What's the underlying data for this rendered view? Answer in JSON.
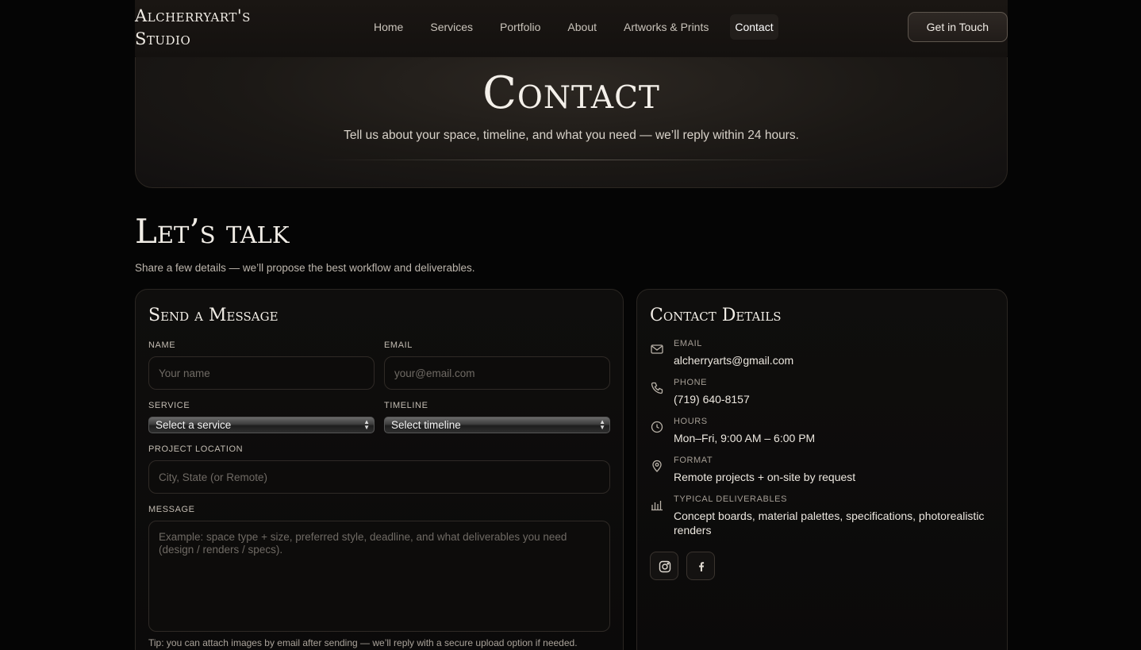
{
  "header": {
    "brand_line1": "Alcherryart's",
    "brand_line2": "Studio",
    "nav": [
      "Home",
      "Services",
      "Portfolio",
      "About",
      "Artworks & Prints",
      "Contact"
    ],
    "active_nav": "Contact",
    "cta_label": "Get in Touch"
  },
  "hero": {
    "title": "Contact",
    "subtitle": "Tell us about your space, timeline, and what you need — we’ll reply within 24 hours."
  },
  "section": {
    "title": "Let’s talk",
    "subtitle": "Share a few details — we’ll propose the best workflow and deliverables."
  },
  "form": {
    "title": "Send a Message",
    "name_label": "NAME",
    "name_placeholder": "Your name",
    "email_label": "EMAIL",
    "email_placeholder": "your@email.com",
    "service_label": "SERVICE",
    "service_value": "Select a service",
    "timeline_label": "TIMELINE",
    "timeline_value": "Select timeline",
    "location_label": "PROJECT LOCATION",
    "location_placeholder": "City, State (or Remote)",
    "message_label": "MESSAGE",
    "message_placeholder": "Example: space type + size, preferred style, deadline, and what deliverables you need (design / renders / specs).",
    "tip": "Tip: you can attach images by email after sending — we’ll reply with a secure upload option if needed."
  },
  "details": {
    "title": "Contact Details",
    "items": [
      {
        "icon": "mail-icon",
        "label": "EMAIL",
        "value": "alcherryarts@gmail.com"
      },
      {
        "icon": "phone-icon",
        "label": "PHONE",
        "value": "(719) 640-8157"
      },
      {
        "icon": "clock-icon",
        "label": "HOURS",
        "value": "Mon–Fri, 9:00 AM – 6:00 PM"
      },
      {
        "icon": "location-pin-icon",
        "label": "FORMAT",
        "value": "Remote projects + on-site by request"
      },
      {
        "icon": "bar-chart-icon",
        "label": "TYPICAL DELIVERABLES",
        "value": "Concept boards, material palettes, specifications, photorealistic renders"
      }
    ],
    "socials": [
      "instagram-icon",
      "facebook-icon"
    ]
  },
  "colors": {
    "background": "#050505",
    "card": "#0f0e0d",
    "border": "#2a2622",
    "text": "#e9e4dc"
  }
}
